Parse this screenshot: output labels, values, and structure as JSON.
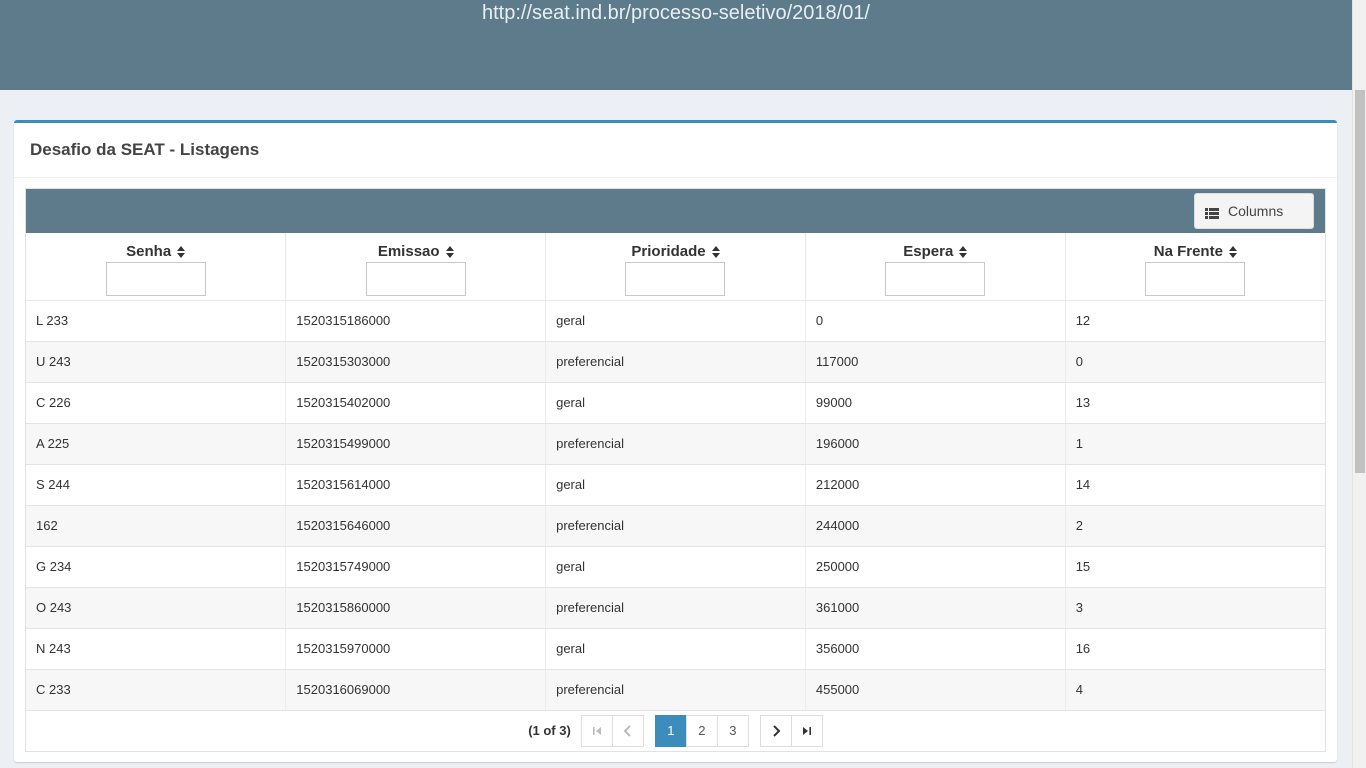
{
  "banner": {
    "url_text": "http://seat.ind.br/processo-seletivo/2018/01/"
  },
  "box": {
    "title": "Desafio da SEAT - Listagens"
  },
  "toolbar": {
    "columns_label": "Columns",
    "columns_icon": "list-icon"
  },
  "table": {
    "headers": [
      "Senha",
      "Emissao",
      "Prioridade",
      "Espera",
      "Na Frente"
    ],
    "rows": [
      [
        "L 233",
        "1520315186000",
        "geral",
        "0",
        "12"
      ],
      [
        "U 243",
        "1520315303000",
        "preferencial",
        "117000",
        "0"
      ],
      [
        "C 226",
        "1520315402000",
        "geral",
        "99000",
        "13"
      ],
      [
        "A 225",
        "1520315499000",
        "preferencial",
        "196000",
        "1"
      ],
      [
        "S 244",
        "1520315614000",
        "geral",
        "212000",
        "14"
      ],
      [
        "162",
        "1520315646000",
        "preferencial",
        "244000",
        "2"
      ],
      [
        "G 234",
        "1520315749000",
        "geral",
        "250000",
        "15"
      ],
      [
        "O 243",
        "1520315860000",
        "preferencial",
        "361000",
        "3"
      ],
      [
        "N 243",
        "1520315970000",
        "geral",
        "356000",
        "16"
      ],
      [
        "C 233",
        "1520316069000",
        "preferencial",
        "455000",
        "4"
      ]
    ]
  },
  "paginator": {
    "current_text": "(1 of 3)",
    "pages": [
      "1",
      "2",
      "3"
    ],
    "active_page": "1"
  },
  "colors": {
    "banner": "#5d7b8b",
    "accent": "#3c8dbc"
  }
}
